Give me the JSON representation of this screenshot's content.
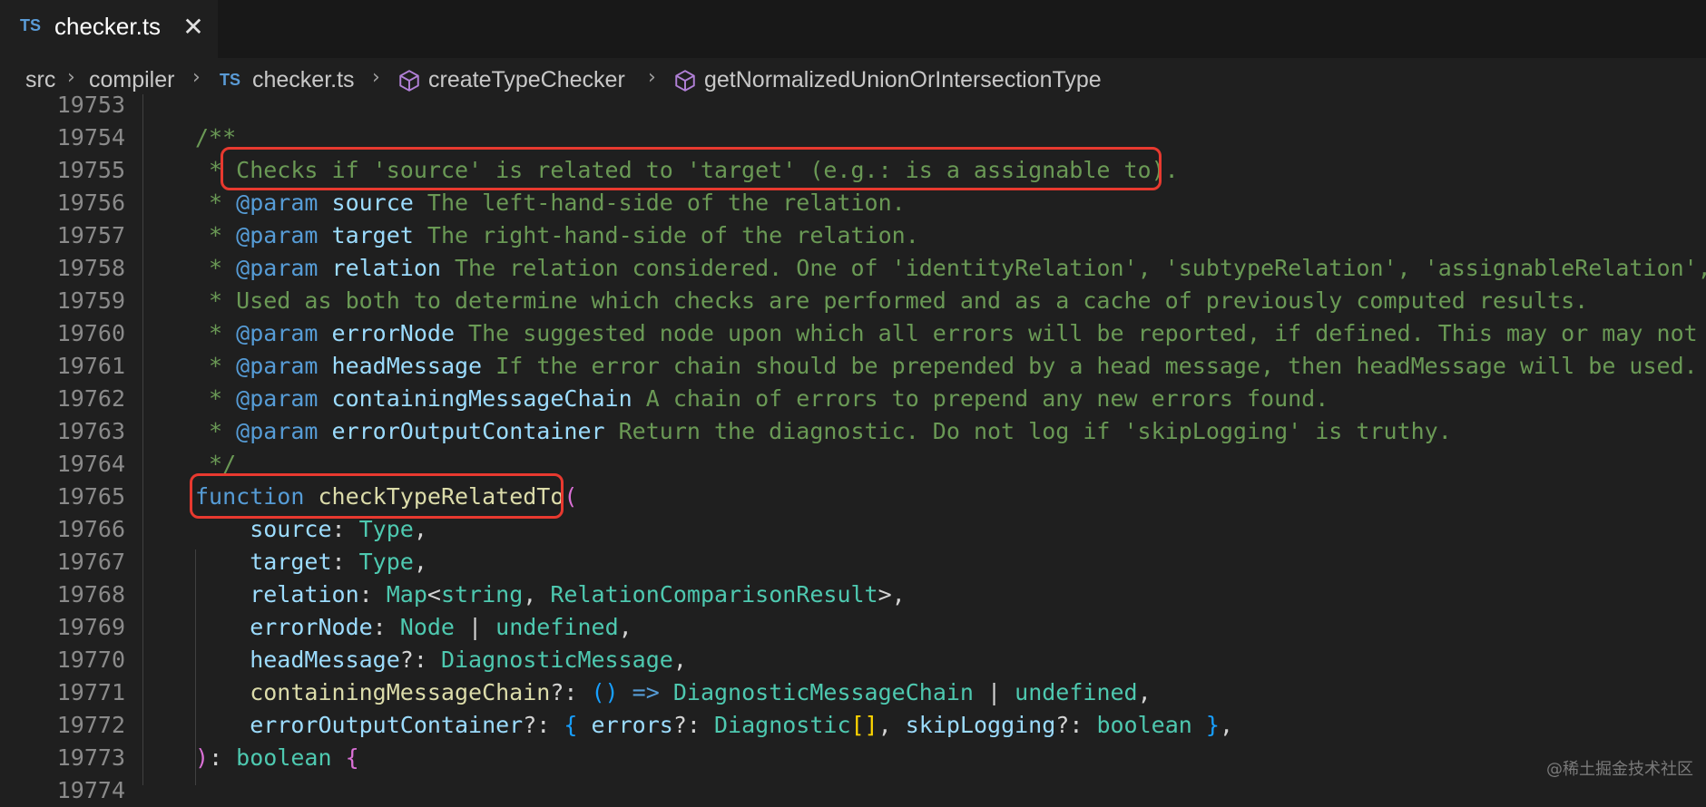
{
  "tab": {
    "lang": "TS",
    "title": "checker.ts",
    "close": "✕"
  },
  "breadcrumb": {
    "src": "src",
    "compiler": "compiler",
    "lang": "TS",
    "file": "checker.ts",
    "sym1": "createTypeChecker",
    "sym2": "getNormalizedUnionOrIntersectionType",
    "separator": "›"
  },
  "colors": {
    "comment": "#6a9955",
    "keyword": "#569cd6",
    "function": "#dcdcaa",
    "param": "#9cdcfe",
    "type": "#4ec9b0",
    "highlight": "#e8392f"
  },
  "lines": [
    {
      "n": "19753",
      "tokens": []
    },
    {
      "n": "19754",
      "tokens": [
        {
          "t": "/**",
          "c": "c"
        }
      ]
    },
    {
      "n": "19755",
      "tokens": [
        {
          "t": " * Checks if 'source' is related to 'target' (e.g.: is a assignable to).",
          "c": "c"
        }
      ]
    },
    {
      "n": "19756",
      "tokens": [
        {
          "t": " * ",
          "c": "c"
        },
        {
          "t": "@param",
          "c": "kw"
        },
        {
          "t": " ",
          "c": "c"
        },
        {
          "t": "source",
          "c": "pm"
        },
        {
          "t": " The left-hand-side of the relation.",
          "c": "c"
        }
      ]
    },
    {
      "n": "19757",
      "tokens": [
        {
          "t": " * ",
          "c": "c"
        },
        {
          "t": "@param",
          "c": "kw"
        },
        {
          "t": " ",
          "c": "c"
        },
        {
          "t": "target",
          "c": "pm"
        },
        {
          "t": " The right-hand-side of the relation.",
          "c": "c"
        }
      ]
    },
    {
      "n": "19758",
      "tokens": [
        {
          "t": " * ",
          "c": "c"
        },
        {
          "t": "@param",
          "c": "kw"
        },
        {
          "t": " ",
          "c": "c"
        },
        {
          "t": "relation",
          "c": "pm"
        },
        {
          "t": " The relation considered. One of 'identityRelation', 'subtypeRelation', 'assignableRelation', or",
          "c": "c"
        }
      ]
    },
    {
      "n": "19759",
      "tokens": [
        {
          "t": " * Used as both to determine which checks are performed and as a cache of previously computed results.",
          "c": "c"
        }
      ]
    },
    {
      "n": "19760",
      "tokens": [
        {
          "t": " * ",
          "c": "c"
        },
        {
          "t": "@param",
          "c": "kw"
        },
        {
          "t": " ",
          "c": "c"
        },
        {
          "t": "errorNode",
          "c": "pm"
        },
        {
          "t": " The suggested node upon which all errors will be reported, if defined. This may or may not be th",
          "c": "c"
        }
      ]
    },
    {
      "n": "19761",
      "tokens": [
        {
          "t": " * ",
          "c": "c"
        },
        {
          "t": "@param",
          "c": "kw"
        },
        {
          "t": " ",
          "c": "c"
        },
        {
          "t": "headMessage",
          "c": "pm"
        },
        {
          "t": " If the error chain should be prepended by a head message, then headMessage will be used.",
          "c": "c"
        }
      ]
    },
    {
      "n": "19762",
      "tokens": [
        {
          "t": " * ",
          "c": "c"
        },
        {
          "t": "@param",
          "c": "kw"
        },
        {
          "t": " ",
          "c": "c"
        },
        {
          "t": "containingMessageChain",
          "c": "pm"
        },
        {
          "t": " A chain of errors to prepend any new errors found.",
          "c": "c"
        }
      ]
    },
    {
      "n": "19763",
      "tokens": [
        {
          "t": " * ",
          "c": "c"
        },
        {
          "t": "@param",
          "c": "kw"
        },
        {
          "t": " ",
          "c": "c"
        },
        {
          "t": "errorOutputContainer",
          "c": "pm"
        },
        {
          "t": " Return the diagnostic. Do not log if 'skipLogging' is truthy.",
          "c": "c"
        }
      ]
    },
    {
      "n": "19764",
      "tokens": [
        {
          "t": " */",
          "c": "c"
        }
      ]
    },
    {
      "n": "19765",
      "tokens": [
        {
          "t": "function",
          "c": "kw"
        },
        {
          "t": " ",
          "c": "wh"
        },
        {
          "t": "checkTypeRelatedTo",
          "c": "fn"
        },
        {
          "t": "(",
          "c": "br2"
        }
      ]
    },
    {
      "n": "19766",
      "tokens": [
        {
          "t": "    source",
          "c": "pm"
        },
        {
          "t": ": ",
          "c": "wh"
        },
        {
          "t": "Type",
          "c": "ty"
        },
        {
          "t": ",",
          "c": "wh"
        }
      ]
    },
    {
      "n": "19767",
      "tokens": [
        {
          "t": "    target",
          "c": "pm"
        },
        {
          "t": ": ",
          "c": "wh"
        },
        {
          "t": "Type",
          "c": "ty"
        },
        {
          "t": ",",
          "c": "wh"
        }
      ]
    },
    {
      "n": "19768",
      "tokens": [
        {
          "t": "    relation",
          "c": "pm"
        },
        {
          "t": ": ",
          "c": "wh"
        },
        {
          "t": "Map",
          "c": "ty"
        },
        {
          "t": "<",
          "c": "wh"
        },
        {
          "t": "string",
          "c": "ty"
        },
        {
          "t": ", ",
          "c": "wh"
        },
        {
          "t": "RelationComparisonResult",
          "c": "ty"
        },
        {
          "t": ">,",
          "c": "wh"
        }
      ]
    },
    {
      "n": "19769",
      "tokens": [
        {
          "t": "    errorNode",
          "c": "pm"
        },
        {
          "t": ": ",
          "c": "wh"
        },
        {
          "t": "Node",
          "c": "ty"
        },
        {
          "t": " | ",
          "c": "wh"
        },
        {
          "t": "undefined",
          "c": "ty"
        },
        {
          "t": ",",
          "c": "wh"
        }
      ]
    },
    {
      "n": "19770",
      "tokens": [
        {
          "t": "    headMessage",
          "c": "pm"
        },
        {
          "t": "?: ",
          "c": "wh"
        },
        {
          "t": "DiagnosticMessage",
          "c": "ty"
        },
        {
          "t": ",",
          "c": "wh"
        }
      ]
    },
    {
      "n": "19771",
      "tokens": [
        {
          "t": "    containingMessageChain",
          "c": "fn"
        },
        {
          "t": "?: ",
          "c": "wh"
        },
        {
          "t": "()",
          "c": "br3"
        },
        {
          "t": " ",
          "c": "wh"
        },
        {
          "t": "=>",
          "c": "kw"
        },
        {
          "t": " ",
          "c": "wh"
        },
        {
          "t": "DiagnosticMessageChain",
          "c": "ty"
        },
        {
          "t": " | ",
          "c": "wh"
        },
        {
          "t": "undefined",
          "c": "ty"
        },
        {
          "t": ",",
          "c": "wh"
        }
      ]
    },
    {
      "n": "19772",
      "tokens": [
        {
          "t": "    errorOutputContainer",
          "c": "pm"
        },
        {
          "t": "?: ",
          "c": "wh"
        },
        {
          "t": "{",
          "c": "br3"
        },
        {
          "t": " ",
          "c": "wh"
        },
        {
          "t": "errors",
          "c": "pm"
        },
        {
          "t": "?: ",
          "c": "wh"
        },
        {
          "t": "Diagnostic",
          "c": "ty"
        },
        {
          "t": "[]",
          "c": "br1"
        },
        {
          "t": ", ",
          "c": "wh"
        },
        {
          "t": "skipLogging",
          "c": "pm"
        },
        {
          "t": "?: ",
          "c": "wh"
        },
        {
          "t": "boolean",
          "c": "ty"
        },
        {
          "t": " ",
          "c": "wh"
        },
        {
          "t": "}",
          "c": "br3"
        },
        {
          "t": ",",
          "c": "wh"
        }
      ]
    },
    {
      "n": "19773",
      "tokens": [
        {
          "t": ")",
          "c": "br2"
        },
        {
          "t": ": ",
          "c": "wh"
        },
        {
          "t": "boolean",
          "c": "ty"
        },
        {
          "t": " ",
          "c": "wh"
        },
        {
          "t": "{",
          "c": "br2"
        }
      ]
    },
    {
      "n": "19774",
      "tokens": []
    }
  ],
  "watermark": "@稀土掘金技术社区"
}
